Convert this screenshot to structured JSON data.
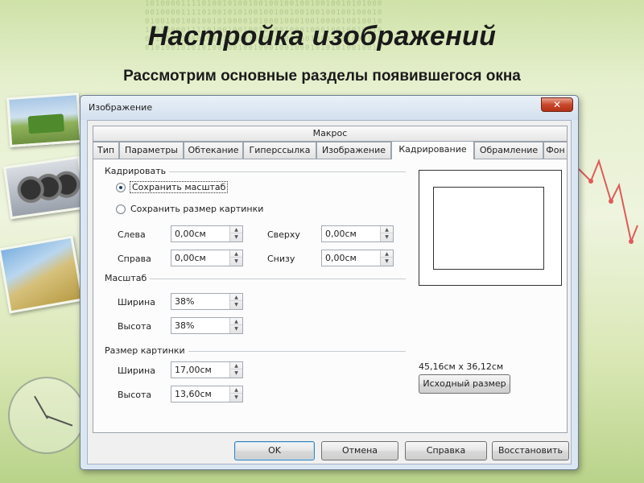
{
  "slide": {
    "title": "Настройка изображений",
    "subtitle": "Рассмотрим основные разделы появившегося окна"
  },
  "background": {
    "binary_lines": [
      "1010000111101001010010010010010010010010101000",
      "0010000111101001010100100100100100100100100010",
      "0100100100100101000010100010001001000010010010",
      "1001000011110100100100101001000100010010010010",
      "0010100100010001000010100100010010001001000100",
      "0101001010101001001001000100100010101010010010"
    ]
  },
  "dialog": {
    "title": "Изображение",
    "close_glyph": "✕",
    "header_tab": "Макрос",
    "tabs": [
      {
        "label": "Тип",
        "active": false
      },
      {
        "label": "Параметры",
        "active": false
      },
      {
        "label": "Обтекание",
        "active": false
      },
      {
        "label": "Гиперссылка",
        "active": false
      },
      {
        "label": "Изображение",
        "active": false
      },
      {
        "label": "Кадрирование",
        "active": true
      },
      {
        "label": "Обрамление",
        "active": false
      },
      {
        "label": "Фон",
        "active": false
      }
    ],
    "crop": {
      "group_label": "Кадрировать",
      "keep_scale": "Сохранить масштаб",
      "keep_size": "Сохранить размер картинки",
      "selected": "keep_scale",
      "left_label": "Слева",
      "left_value": "0,00см",
      "right_label": "Справа",
      "right_value": "0,00см",
      "top_label": "Сверху",
      "top_value": "0,00см",
      "bottom_label": "Снизу",
      "bottom_value": "0,00см"
    },
    "scale": {
      "group_label": "Масштаб",
      "width_label": "Ширина",
      "width_value": "38%",
      "height_label": "Высота",
      "height_value": "38%"
    },
    "image_size": {
      "group_label": "Размер картинки",
      "width_label": "Ширина",
      "width_value": "17,00см",
      "height_label": "Высота",
      "height_value": "13,60см"
    },
    "original_size_readout": "45,16см x 36,12см",
    "original_size_button": "Исходный размер",
    "buttons": {
      "ok": "OK",
      "cancel": "Отмена",
      "help": "Справка",
      "reset": "Восстановить"
    }
  }
}
